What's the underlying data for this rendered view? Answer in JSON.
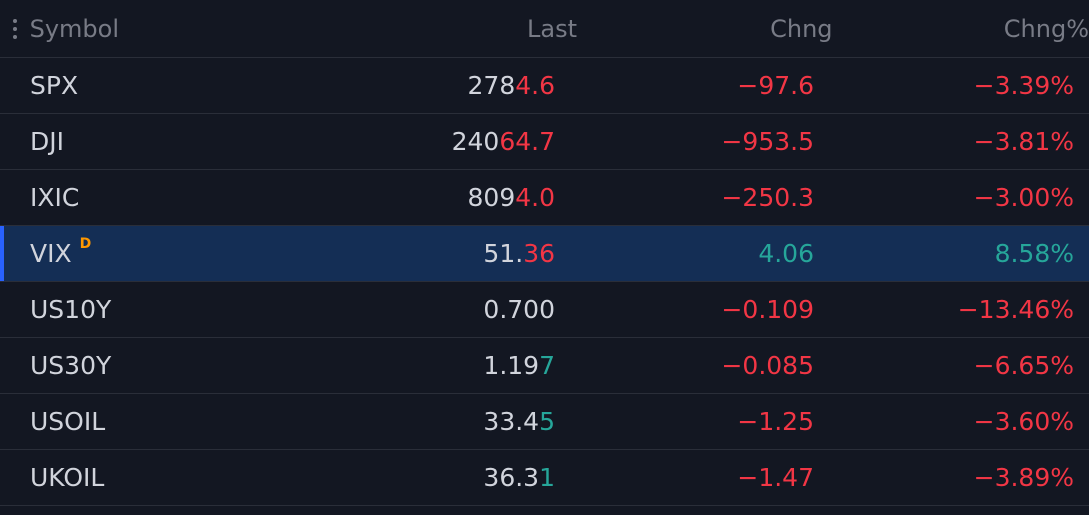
{
  "header": {
    "symbol": "Symbol",
    "last": "Last",
    "chng": "Chng",
    "chng_pct": "Chng%"
  },
  "colors": {
    "up": "#26a69a",
    "down": "#f23645",
    "badge": "#ff9800",
    "selected_bg": "#142e55"
  },
  "rows": [
    {
      "symbol": "SPX",
      "last_head": "278",
      "last_tail": "4.6",
      "last_tail_dir": "down",
      "chng": "−97.6",
      "chng_pct": "−3.39%",
      "dir": "down"
    },
    {
      "symbol": "DJI",
      "last_head": "240",
      "last_tail": "64.7",
      "last_tail_dir": "down",
      "chng": "−953.5",
      "chng_pct": "−3.81%",
      "dir": "down"
    },
    {
      "symbol": "IXIC",
      "last_head": "809",
      "last_tail": "4.0",
      "last_tail_dir": "down",
      "chng": "−250.3",
      "chng_pct": "−3.00%",
      "dir": "down"
    },
    {
      "symbol": "VIX",
      "badge": "D",
      "last_head": "51.",
      "last_tail": "36",
      "last_tail_dir": "down",
      "chng": "4.06",
      "chng_pct": "8.58%",
      "dir": "up",
      "selected": true
    },
    {
      "symbol": "US10Y",
      "last_head": "0.700",
      "last_tail": "",
      "last_tail_dir": "none",
      "chng": "−0.109",
      "chng_pct": "−13.46%",
      "dir": "down"
    },
    {
      "symbol": "US30Y",
      "last_head": "1.19",
      "last_tail": "7",
      "last_tail_dir": "up",
      "chng": "−0.085",
      "chng_pct": "−6.65%",
      "dir": "down"
    },
    {
      "symbol": "USOIL",
      "last_head": "33.4",
      "last_tail": "5",
      "last_tail_dir": "up",
      "chng": "−1.25",
      "chng_pct": "−3.60%",
      "dir": "down"
    },
    {
      "symbol": "UKOIL",
      "last_head": "36.3",
      "last_tail": "1",
      "last_tail_dir": "up",
      "chng": "−1.47",
      "chng_pct": "−3.89%",
      "dir": "down"
    }
  ]
}
